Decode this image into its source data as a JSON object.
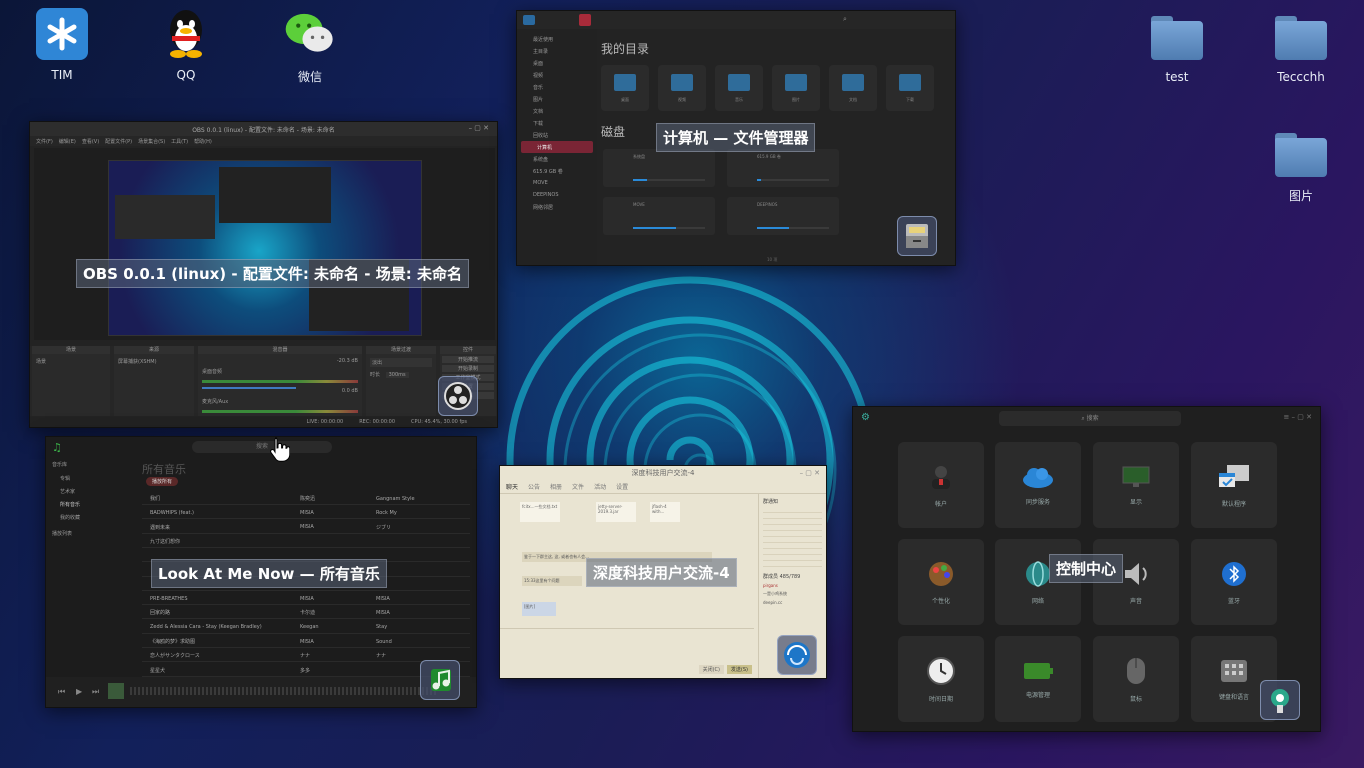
{
  "desktop": {
    "icons": [
      {
        "label": "TIM",
        "icon": "tim-icon"
      },
      {
        "label": "QQ",
        "icon": "qq-penguin-icon"
      },
      {
        "label": "微信",
        "icon": "wechat-icon"
      },
      {
        "label": "test",
        "icon": "folder-icon"
      },
      {
        "label": "Teccchh",
        "icon": "folder-icon"
      },
      {
        "label": "图片",
        "icon": "folder-icon"
      }
    ]
  },
  "windows": {
    "obs": {
      "title": "OBS 0.0.1 (linux) - 配置文件: 未命名 - 场景: 未命名",
      "small_title": "OBS 0.0.1 (linux) - 配置文件: 未命名 - 场景: 未命名",
      "menu": [
        "文件(F)",
        "编辑(E)",
        "查看(V)",
        "配置文件(P)",
        "场景集合(S)",
        "工具(T)",
        "帮助(H)"
      ],
      "panels": [
        "场景",
        "来源",
        "混音器",
        "场景过渡",
        "控件"
      ],
      "scene_item": "场景",
      "source_item": "屏幕捕获(XSHM)",
      "mixer": [
        {
          "name": "桌面音频",
          "db": "-20.3 dB"
        },
        {
          "name": "麦克风/Aux",
          "db": "0.0 dB"
        }
      ],
      "transition": {
        "value": "淡出",
        "duration_label": "时长",
        "duration": "300ms"
      },
      "controls": [
        "开始推流",
        "开始录制",
        "工作室模式",
        "设置",
        "退出"
      ],
      "status": [
        "LIVE: 00:00:00",
        "REC: 00:00:00",
        "CPU: 45.4%, 30.00 fps"
      ]
    },
    "file_manager": {
      "title": "计算机 — 文件管理器",
      "section_dirs": "我的目录",
      "section_disks": "磁盘",
      "sidebar": [
        "最近使用",
        "主目录",
        "桌面",
        "视频",
        "音乐",
        "图片",
        "文档",
        "下载",
        "回收站",
        "计算机",
        "系统盘",
        "615.9 GB 卷",
        "MOVE",
        "DEEPINOS",
        "网络邻居"
      ],
      "dirs": [
        "桌面",
        "视频",
        "音乐",
        "图片",
        "文档",
        "下载"
      ],
      "disks": [
        {
          "name": "系统盘",
          "fill": 0.2
        },
        {
          "name": "615.9 GB 卷",
          "fill": 0.05
        },
        {
          "name": "MOVE",
          "fill": 0.6
        },
        {
          "name": "DEEPINOS",
          "fill": 0.45
        }
      ],
      "footer": "10 项"
    },
    "music": {
      "title": "Look At Me Now — 所有音乐",
      "search_placeholder": "搜索",
      "header": "所有音乐",
      "sidebar_group": "音乐库",
      "sidebar": [
        "专辑",
        "艺术家",
        "所有音乐",
        "我的收藏"
      ],
      "sidebar_group2": "播放列表",
      "play_all": "播放所有",
      "songs": [
        [
          "我们",
          "陈奕迅",
          "Gangnam Style"
        ],
        [
          "BADWHIPS (feat.)",
          "MISIA",
          "Rock My"
        ],
        [
          "遇到未来",
          "MISIA",
          "ジブリ"
        ],
        [
          "九寸这们想你",
          "",
          ""
        ],
        [
          "",
          "",
          ""
        ],
        [
          "",
          "",
          ""
        ],
        [
          "",
          "",
          ""
        ],
        [
          "PRE-BREATHES",
          "MISIA",
          "MISIA"
        ],
        [
          "回家的路",
          "卡尔迪",
          "MISIA"
        ],
        [
          "Zedd & Alessia Cara - Stay (Keegan Bradley)",
          "Keegan",
          "Stay"
        ],
        [
          "《海鸥的梦》求助图",
          "MISIA",
          "Sound"
        ],
        [
          "恋人がサンタクロース",
          "ナナ",
          "ナナ"
        ],
        [
          "星星犬",
          "多多",
          ""
        ]
      ]
    },
    "chat": {
      "title": "深度科技用户交流-4",
      "window_title": "深度科技用户交流-4",
      "tabs": [
        "聊天",
        "公告",
        "相册",
        "文件",
        "活动",
        "设置"
      ],
      "notice_title": "群通知",
      "members_label": "群成员 485/789",
      "files": [
        "fcitx...一些文档.txt",
        "jetty-server-2019.3.jar",
        "jflash-4 with..."
      ],
      "messages": [
        "鉴于一下群主这, 这, 或者也有人会...",
        "15:33这里有个问题",
        "[图片]"
      ],
      "buttons": [
        "关闭(C)",
        "发送(S)"
      ],
      "members": [
        "pirgans",
        "一是小鸡系统",
        "deepin.cc",
        "",
        "",
        "",
        "",
        "",
        ""
      ]
    },
    "control_center": {
      "title": "控制中心",
      "search_placeholder": "搜索",
      "tiles": [
        "帐户",
        "同步服务",
        "显示",
        "默认程序",
        "个性化",
        "网络",
        "声音",
        "蓝牙",
        "时间日期",
        "电源管理",
        "鼠标",
        "键盘和语言"
      ]
    }
  },
  "colors": {
    "accent": "#2a8ad8",
    "overlay": "#5a6478",
    "window_bg": "#232323"
  }
}
